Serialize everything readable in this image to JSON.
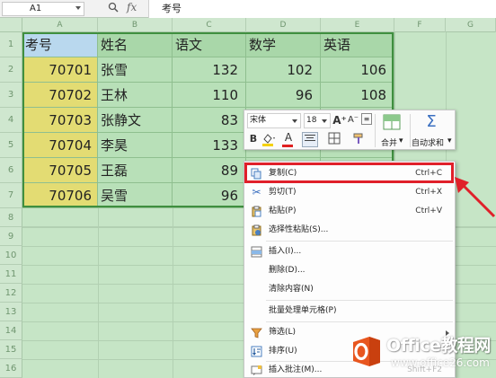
{
  "formula_bar": {
    "cell_ref": "A1",
    "content": "考号",
    "zoom_icon": "magnifier-icon",
    "fx_label": "fx"
  },
  "columns": [
    "A",
    "B",
    "C",
    "D",
    "E",
    "F",
    "G"
  ],
  "rows": [
    "1",
    "2",
    "3",
    "4",
    "5",
    "6",
    "7",
    "8",
    "9",
    "10",
    "11",
    "12",
    "13",
    "14",
    "15",
    "16"
  ],
  "table": {
    "headers": [
      "考号",
      "姓名",
      "语文",
      "数学",
      "英语"
    ],
    "records": [
      [
        "70701",
        "张雪",
        "132",
        "102",
        "106"
      ],
      [
        "70702",
        "王林",
        "110",
        "96",
        "108"
      ],
      [
        "70703",
        "张静文",
        "83",
        "",
        ""
      ],
      [
        "70704",
        "李昊",
        "133",
        "",
        ""
      ],
      [
        "70705",
        "王磊",
        "89",
        "",
        ""
      ],
      [
        "70706",
        "吴雪",
        "96",
        "",
        ""
      ]
    ]
  },
  "mini_toolbar": {
    "font_name": "宋体",
    "font_size": "18",
    "grow_icon": "A⁺",
    "shrink_icon": "A⁻",
    "bold": "B",
    "merge_label": "合并",
    "autosum_label": "自动求和",
    "sum_symbol": "Σ",
    "font_color_label": "A"
  },
  "context_menu": {
    "items": [
      {
        "label": "复制(C)",
        "shortcut": "Ctrl+C",
        "icon": "copy-icon"
      },
      {
        "label": "剪切(T)",
        "shortcut": "Ctrl+X",
        "icon": "scissors-icon"
      },
      {
        "label": "粘贴(P)",
        "shortcut": "Ctrl+V",
        "icon": "paste-icon"
      },
      {
        "label": "选择性粘贴(S)...",
        "shortcut": "",
        "icon": "paste-special-icon"
      },
      {
        "label": "插入(I)...",
        "shortcut": "",
        "icon": "insert-cells-icon"
      },
      {
        "label": "删除(D)...",
        "shortcut": "",
        "icon": ""
      },
      {
        "label": "清除内容(N)",
        "shortcut": "",
        "icon": ""
      },
      {
        "label": "批量处理单元格(P)",
        "shortcut": "",
        "icon": ""
      },
      {
        "label": "筛选(L)",
        "shortcut": "",
        "icon": "filter-icon"
      },
      {
        "label": "排序(U)",
        "shortcut": "",
        "icon": "sort-icon"
      },
      {
        "label": "插入批注(M)...",
        "shortcut": "",
        "icon": "comment-icon"
      }
    ],
    "partial_hint": "Shift+F2"
  },
  "watermark": {
    "title": "Office教程网",
    "url": "www.office26.com"
  },
  "colors": {
    "highlight": "#e0202a",
    "header_blue": "#b9d8ee",
    "id_yellow": "#e3dc73",
    "grid_green": "#c6e5c6"
  }
}
